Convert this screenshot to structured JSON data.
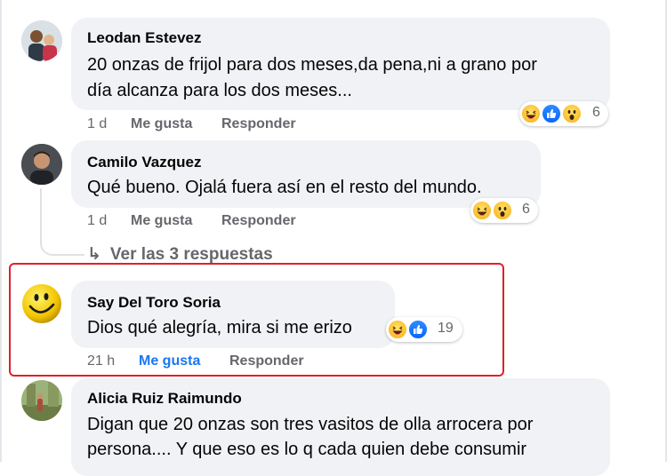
{
  "comments": [
    {
      "name": "Leodan Estevez",
      "text_line1": "20 onzas de frijol para dos meses,da pena,ni a grano por",
      "text_line2": "día alcanza para los dos meses...",
      "time": "1 d",
      "like_label": "Me gusta",
      "reply_label": "Responder",
      "reactions": [
        "haha-icon",
        "like-icon",
        "wow-icon"
      ],
      "reaction_count": "6"
    },
    {
      "name": "Camilo Vazquez",
      "text_line1": "Qué bueno. Ojalá fuera así en el resto del mundo.",
      "time": "1 d",
      "like_label": "Me gusta",
      "reply_label": "Responder",
      "reactions": [
        "haha-icon",
        "wow-icon"
      ],
      "reaction_count": "6",
      "view_replies": "Ver las 3 respuestas"
    },
    {
      "name": "Say Del Toro Soria",
      "text_line1": "Dios qué alegría, mira si me erizo",
      "time": "21 h",
      "like_label": "Me gusta",
      "reply_label": "Responder",
      "reactions": [
        "haha-icon",
        "like-icon"
      ],
      "reaction_count": "19",
      "liked": true
    },
    {
      "name": "Alicia Ruiz Raimundo",
      "text_line1": "Digan que 20 onzas son tres vasitos de olla arrocera por",
      "text_line2": "persona.... Y que eso es lo q cada quien debe consumir"
    }
  ],
  "colors": {
    "highlight": "#e0202a",
    "like_active": "#1877f2",
    "bubble": "#f0f2f5",
    "meta": "#65676b"
  }
}
